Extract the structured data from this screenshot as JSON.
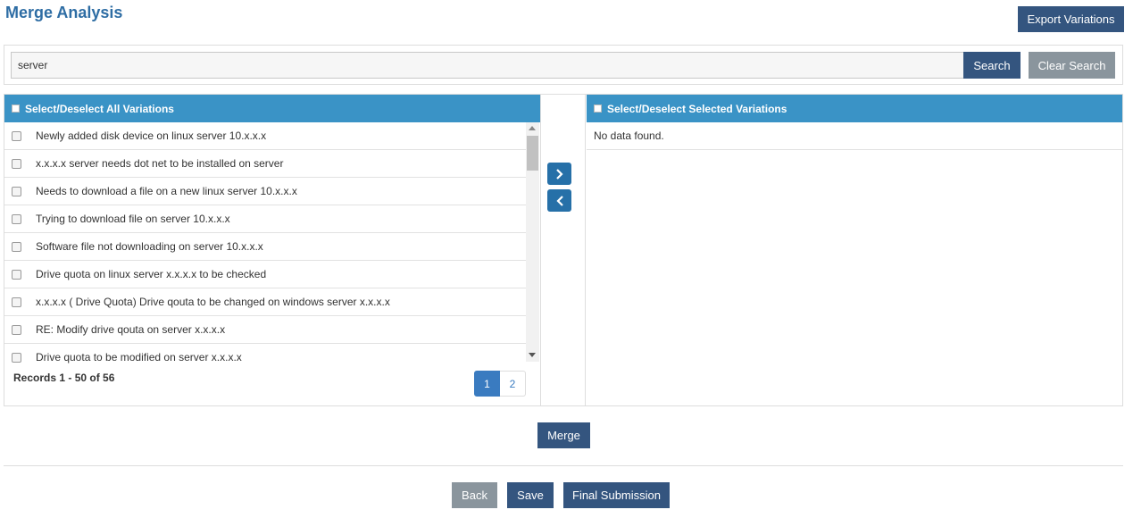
{
  "page": {
    "title": "Merge Analysis"
  },
  "toolbar": {
    "export_label": "Export Variations"
  },
  "search": {
    "value": "server",
    "search_label": "Search",
    "clear_label": "Clear Search"
  },
  "left_panel": {
    "header": "Select/Deselect All Variations",
    "items": [
      "Newly added disk device on linux server 10.x.x.x",
      "x.x.x.x server needs dot net to be installed on server",
      "Needs to download a file on a new linux server 10.x.x.x",
      "Trying to download file on server 10.x.x.x",
      "Software file not downloading on server 10.x.x.x",
      "Drive quota on linux server x.x.x.x to be checked",
      "x.x.x.x ( Drive Quota) Drive qouta to be changed on windows server x.x.x.x",
      "RE: Modify drive qouta on server x.x.x.x",
      "Drive quota to be modified on server x.x.x.x"
    ],
    "records": "Records 1 - 50 of 56",
    "pages": [
      "1",
      "2"
    ]
  },
  "right_panel": {
    "header": "Select/Deselect Selected Variations",
    "empty_text": "No data found."
  },
  "actions": {
    "merge_label": "Merge",
    "back_label": "Back",
    "save_label": "Save",
    "final_label": "Final Submission"
  },
  "colors": {
    "header_blue": "#3a93c6",
    "button_dark": "#34557f",
    "button_gray": "#8a959d",
    "title_blue": "#2e6da4"
  },
  "icons": {
    "move_right": "chevron-right-icon",
    "move_left": "chevron-left-icon"
  }
}
